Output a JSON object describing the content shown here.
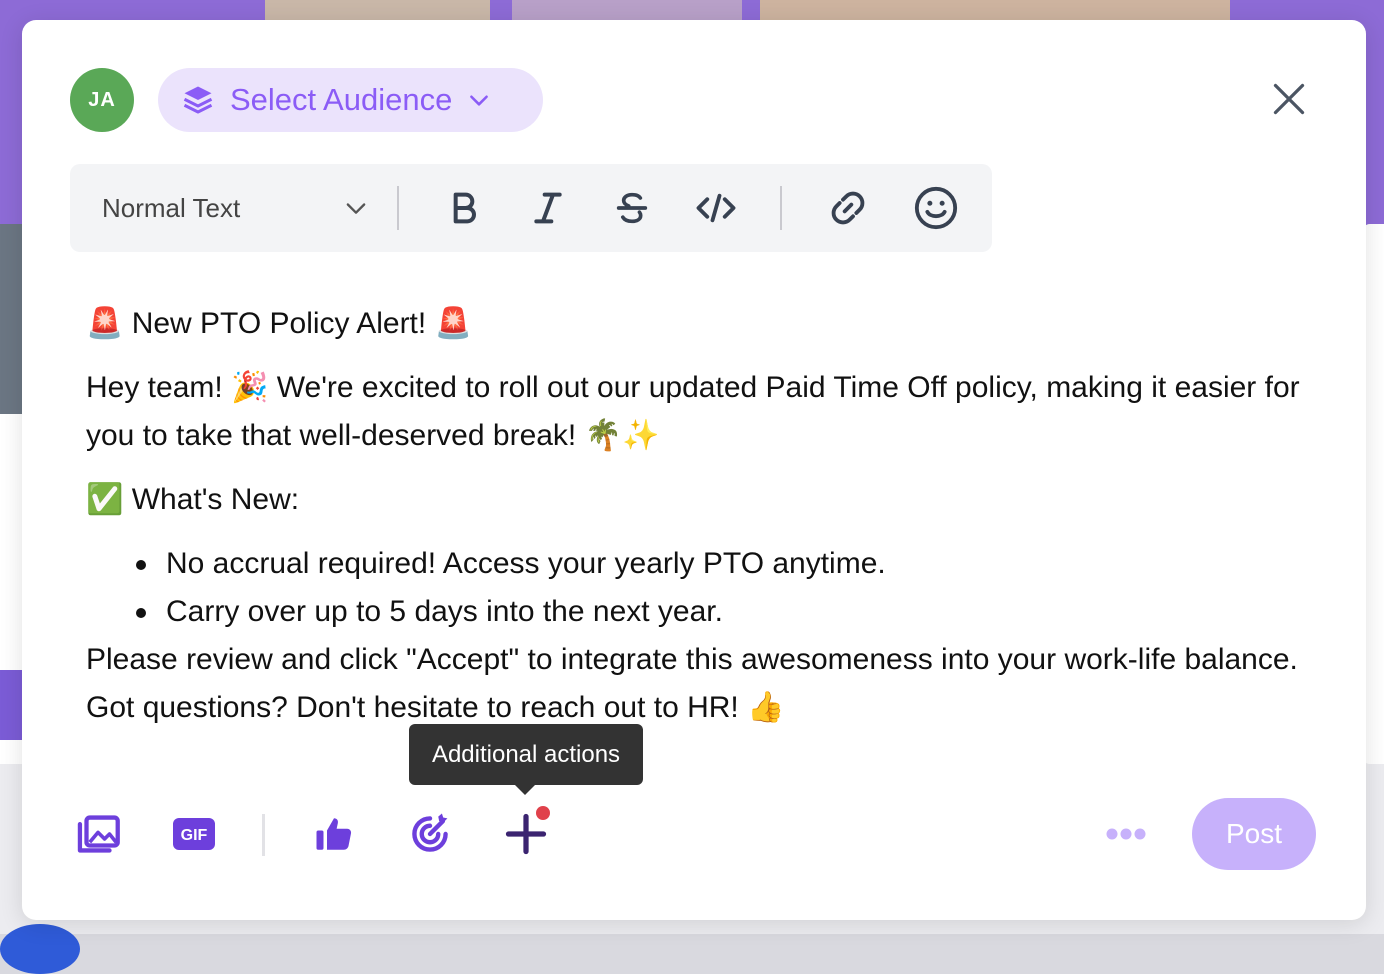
{
  "author": {
    "initials": "JA"
  },
  "audience": {
    "label": "Select Audience"
  },
  "toolbar": {
    "text_style": "Normal Text",
    "buttons": [
      "bold-icon",
      "italic-icon",
      "strikethrough-icon",
      "code-icon",
      "link-icon",
      "emoji-icon"
    ]
  },
  "post": {
    "title_line": "🚨 New PTO Policy Alert! 🚨",
    "intro": "Hey team! 🎉 We're excited to roll out our updated Paid Time Off policy, making it easier for you to take that well-deserved break! 🌴✨",
    "section_heading": "✅ What's New:",
    "bullets": [
      "No accrual required! Access your yearly PTO anytime.",
      "Carry over up to 5 days into the next year."
    ],
    "closing": "Please review and click \"Accept\" to integrate this awesomeness into your work-life balance. Got questions? Don't hesitate to reach out to HR! 👍"
  },
  "footer": {
    "tooltip": "Additional actions",
    "post_label": "Post",
    "icons": [
      "media-icon",
      "gif-icon",
      "thumbs-up-icon",
      "target-icon",
      "plus-icon",
      "more-icon"
    ]
  },
  "colors": {
    "accent": "#8b5cf6",
    "accent_light": "#ebe3fc",
    "avatar": "#5aa857",
    "post_disabled": "#c7b1fb",
    "notification": "#e0414b"
  }
}
